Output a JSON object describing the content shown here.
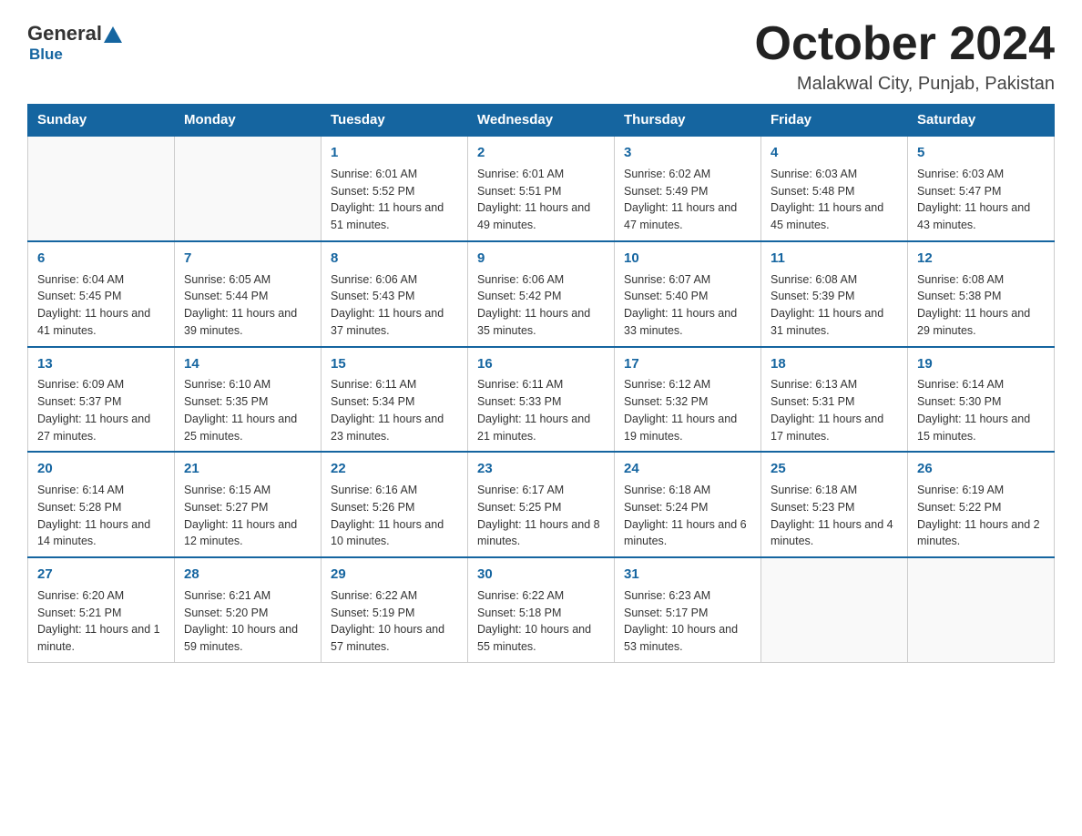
{
  "logo": {
    "general": "General",
    "blue": "Blue"
  },
  "title": {
    "month_year": "October 2024",
    "location": "Malakwal City, Punjab, Pakistan"
  },
  "weekdays": [
    "Sunday",
    "Monday",
    "Tuesday",
    "Wednesday",
    "Thursday",
    "Friday",
    "Saturday"
  ],
  "weeks": [
    [
      {
        "day": "",
        "sunrise": "",
        "sunset": "",
        "daylight": ""
      },
      {
        "day": "",
        "sunrise": "",
        "sunset": "",
        "daylight": ""
      },
      {
        "day": "1",
        "sunrise": "Sunrise: 6:01 AM",
        "sunset": "Sunset: 5:52 PM",
        "daylight": "Daylight: 11 hours and 51 minutes."
      },
      {
        "day": "2",
        "sunrise": "Sunrise: 6:01 AM",
        "sunset": "Sunset: 5:51 PM",
        "daylight": "Daylight: 11 hours and 49 minutes."
      },
      {
        "day": "3",
        "sunrise": "Sunrise: 6:02 AM",
        "sunset": "Sunset: 5:49 PM",
        "daylight": "Daylight: 11 hours and 47 minutes."
      },
      {
        "day": "4",
        "sunrise": "Sunrise: 6:03 AM",
        "sunset": "Sunset: 5:48 PM",
        "daylight": "Daylight: 11 hours and 45 minutes."
      },
      {
        "day": "5",
        "sunrise": "Sunrise: 6:03 AM",
        "sunset": "Sunset: 5:47 PM",
        "daylight": "Daylight: 11 hours and 43 minutes."
      }
    ],
    [
      {
        "day": "6",
        "sunrise": "Sunrise: 6:04 AM",
        "sunset": "Sunset: 5:45 PM",
        "daylight": "Daylight: 11 hours and 41 minutes."
      },
      {
        "day": "7",
        "sunrise": "Sunrise: 6:05 AM",
        "sunset": "Sunset: 5:44 PM",
        "daylight": "Daylight: 11 hours and 39 minutes."
      },
      {
        "day": "8",
        "sunrise": "Sunrise: 6:06 AM",
        "sunset": "Sunset: 5:43 PM",
        "daylight": "Daylight: 11 hours and 37 minutes."
      },
      {
        "day": "9",
        "sunrise": "Sunrise: 6:06 AM",
        "sunset": "Sunset: 5:42 PM",
        "daylight": "Daylight: 11 hours and 35 minutes."
      },
      {
        "day": "10",
        "sunrise": "Sunrise: 6:07 AM",
        "sunset": "Sunset: 5:40 PM",
        "daylight": "Daylight: 11 hours and 33 minutes."
      },
      {
        "day": "11",
        "sunrise": "Sunrise: 6:08 AM",
        "sunset": "Sunset: 5:39 PM",
        "daylight": "Daylight: 11 hours and 31 minutes."
      },
      {
        "day": "12",
        "sunrise": "Sunrise: 6:08 AM",
        "sunset": "Sunset: 5:38 PM",
        "daylight": "Daylight: 11 hours and 29 minutes."
      }
    ],
    [
      {
        "day": "13",
        "sunrise": "Sunrise: 6:09 AM",
        "sunset": "Sunset: 5:37 PM",
        "daylight": "Daylight: 11 hours and 27 minutes."
      },
      {
        "day": "14",
        "sunrise": "Sunrise: 6:10 AM",
        "sunset": "Sunset: 5:35 PM",
        "daylight": "Daylight: 11 hours and 25 minutes."
      },
      {
        "day": "15",
        "sunrise": "Sunrise: 6:11 AM",
        "sunset": "Sunset: 5:34 PM",
        "daylight": "Daylight: 11 hours and 23 minutes."
      },
      {
        "day": "16",
        "sunrise": "Sunrise: 6:11 AM",
        "sunset": "Sunset: 5:33 PM",
        "daylight": "Daylight: 11 hours and 21 minutes."
      },
      {
        "day": "17",
        "sunrise": "Sunrise: 6:12 AM",
        "sunset": "Sunset: 5:32 PM",
        "daylight": "Daylight: 11 hours and 19 minutes."
      },
      {
        "day": "18",
        "sunrise": "Sunrise: 6:13 AM",
        "sunset": "Sunset: 5:31 PM",
        "daylight": "Daylight: 11 hours and 17 minutes."
      },
      {
        "day": "19",
        "sunrise": "Sunrise: 6:14 AM",
        "sunset": "Sunset: 5:30 PM",
        "daylight": "Daylight: 11 hours and 15 minutes."
      }
    ],
    [
      {
        "day": "20",
        "sunrise": "Sunrise: 6:14 AM",
        "sunset": "Sunset: 5:28 PM",
        "daylight": "Daylight: 11 hours and 14 minutes."
      },
      {
        "day": "21",
        "sunrise": "Sunrise: 6:15 AM",
        "sunset": "Sunset: 5:27 PM",
        "daylight": "Daylight: 11 hours and 12 minutes."
      },
      {
        "day": "22",
        "sunrise": "Sunrise: 6:16 AM",
        "sunset": "Sunset: 5:26 PM",
        "daylight": "Daylight: 11 hours and 10 minutes."
      },
      {
        "day": "23",
        "sunrise": "Sunrise: 6:17 AM",
        "sunset": "Sunset: 5:25 PM",
        "daylight": "Daylight: 11 hours and 8 minutes."
      },
      {
        "day": "24",
        "sunrise": "Sunrise: 6:18 AM",
        "sunset": "Sunset: 5:24 PM",
        "daylight": "Daylight: 11 hours and 6 minutes."
      },
      {
        "day": "25",
        "sunrise": "Sunrise: 6:18 AM",
        "sunset": "Sunset: 5:23 PM",
        "daylight": "Daylight: 11 hours and 4 minutes."
      },
      {
        "day": "26",
        "sunrise": "Sunrise: 6:19 AM",
        "sunset": "Sunset: 5:22 PM",
        "daylight": "Daylight: 11 hours and 2 minutes."
      }
    ],
    [
      {
        "day": "27",
        "sunrise": "Sunrise: 6:20 AM",
        "sunset": "Sunset: 5:21 PM",
        "daylight": "Daylight: 11 hours and 1 minute."
      },
      {
        "day": "28",
        "sunrise": "Sunrise: 6:21 AM",
        "sunset": "Sunset: 5:20 PM",
        "daylight": "Daylight: 10 hours and 59 minutes."
      },
      {
        "day": "29",
        "sunrise": "Sunrise: 6:22 AM",
        "sunset": "Sunset: 5:19 PM",
        "daylight": "Daylight: 10 hours and 57 minutes."
      },
      {
        "day": "30",
        "sunrise": "Sunrise: 6:22 AM",
        "sunset": "Sunset: 5:18 PM",
        "daylight": "Daylight: 10 hours and 55 minutes."
      },
      {
        "day": "31",
        "sunrise": "Sunrise: 6:23 AM",
        "sunset": "Sunset: 5:17 PM",
        "daylight": "Daylight: 10 hours and 53 minutes."
      },
      {
        "day": "",
        "sunrise": "",
        "sunset": "",
        "daylight": ""
      },
      {
        "day": "",
        "sunrise": "",
        "sunset": "",
        "daylight": ""
      }
    ]
  ]
}
